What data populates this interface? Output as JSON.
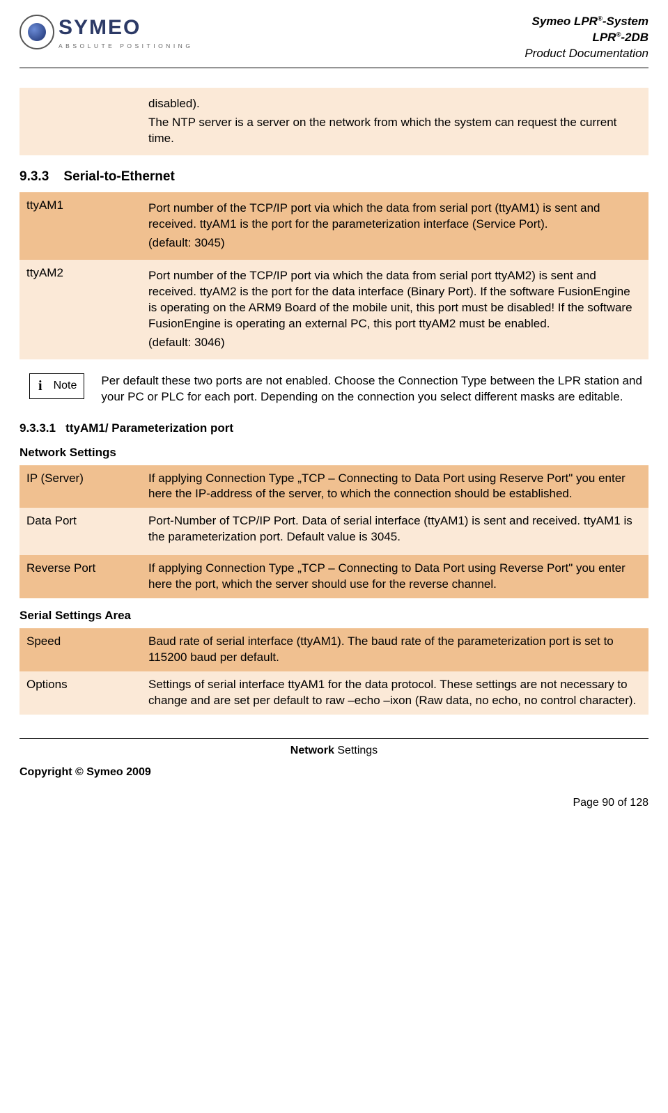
{
  "header": {
    "brand": "SYMEO",
    "brand_tag": "ABSOLUTE POSITIONING",
    "meta_line1_a": "Symeo LPR",
    "meta_line1_b": "-System",
    "meta_line2_a": "LPR",
    "meta_line2_b": "-2DB",
    "meta_line3": "Product Documentation"
  },
  "intro_table": {
    "cell_a": "disabled).",
    "cell_b": "The NTP server is a server on the network from which the system can request the current time."
  },
  "sec933_num": "9.3.3",
  "sec933_title": "Serial-to-Ethernet",
  "serial_table": {
    "r1_label": "ttyAM1",
    "r1_desc_a": "Port number of the TCP/IP port via which the data from serial port (ttyAM1) is sent and received. ttyAM1 is the port for the parameterization interface (Service Port).",
    "r1_desc_b": "(default: 3045)",
    "r2_label": "ttyAM2",
    "r2_desc_a": "Port number of the TCP/IP port via which the data from serial port ttyAM2) is sent and received. ttyAM2 is the port for the data interface (Binary Port). If the software FusionEngine is operating on the ARM9 Board of the mobile unit, this port must be disabled! If the software FusionEngine is operating an external PC, this port ttyAM2 must be enabled.",
    "r2_desc_b": "(default: 3046)"
  },
  "note": {
    "label": "Note",
    "text": "Per default these two ports are not enabled. Choose the Connection Type between the LPR station and your PC or PLC for each port. Depending on the connection you select different masks are editable."
  },
  "sec9331_num": "9.3.3.1",
  "sec9331_title": "ttyAM1/ Parameterization port",
  "ns_heading": "Network Settings",
  "ns_table": {
    "r1_label": "IP (Server)",
    "r1_desc": "If applying Connection Type „TCP – Connecting to Data Port using Reserve Port\" you enter here the IP-address of the server, to which the connection should be established.",
    "r2_label": "Data Port",
    "r2_desc": "Port-Number of TCP/IP Port. Data of serial interface (ttyAM1) is sent and received. ttyAM1 is the parameterization port. Default value is 3045.",
    "r3_label": "Reverse Port",
    "r3_desc": "If applying Connection Type „TCP – Connecting to Data Port using Reverse Port\" you enter here the port, which the server should use for the reverse channel."
  },
  "ss_heading": "Serial Settings Area",
  "ss_table": {
    "r1_label": "Speed",
    "r1_desc": "Baud rate of serial interface (ttyAM1). The baud rate of the parameterization port is set to 115200 baud per default.",
    "r2_label": "Options",
    "r2_desc": "Settings of serial interface ttyAM1 for the data protocol. These settings are not necessary to change and are set per default to raw –echo –ixon (Raw data, no echo, no control character)."
  },
  "footer": {
    "center_bold": "Network",
    "center_rest": " Settings",
    "copyright": "Copyright © Symeo 2009",
    "page": "Page 90 of 128"
  }
}
